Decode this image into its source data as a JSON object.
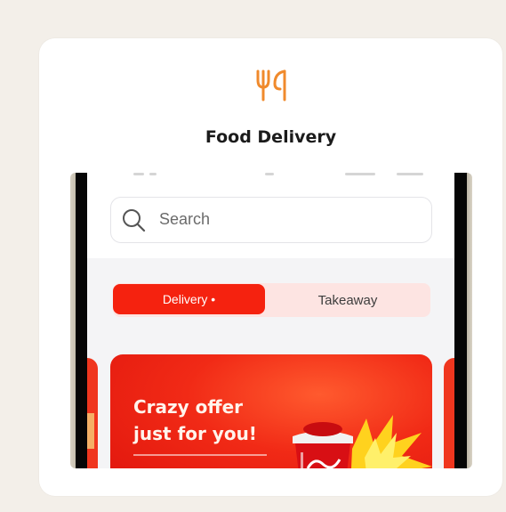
{
  "card": {
    "title": "Food Delivery",
    "icon": "fork-knife-icon",
    "icon_color": "#f08a2c"
  },
  "app": {
    "search": {
      "placeholder": "Search",
      "icon": "search-icon"
    },
    "tabs": {
      "items": [
        {
          "label": "Delivery •",
          "active": true
        },
        {
          "label": "Takeaway",
          "active": false
        }
      ]
    },
    "promo": {
      "headline": "Crazy offer just for you!",
      "image": "cola-cup-illustration"
    }
  },
  "colors": {
    "accent": "#f5220f",
    "tab_inactive_bg": "#fde4e2",
    "page_bg": "#f3efe9"
  }
}
